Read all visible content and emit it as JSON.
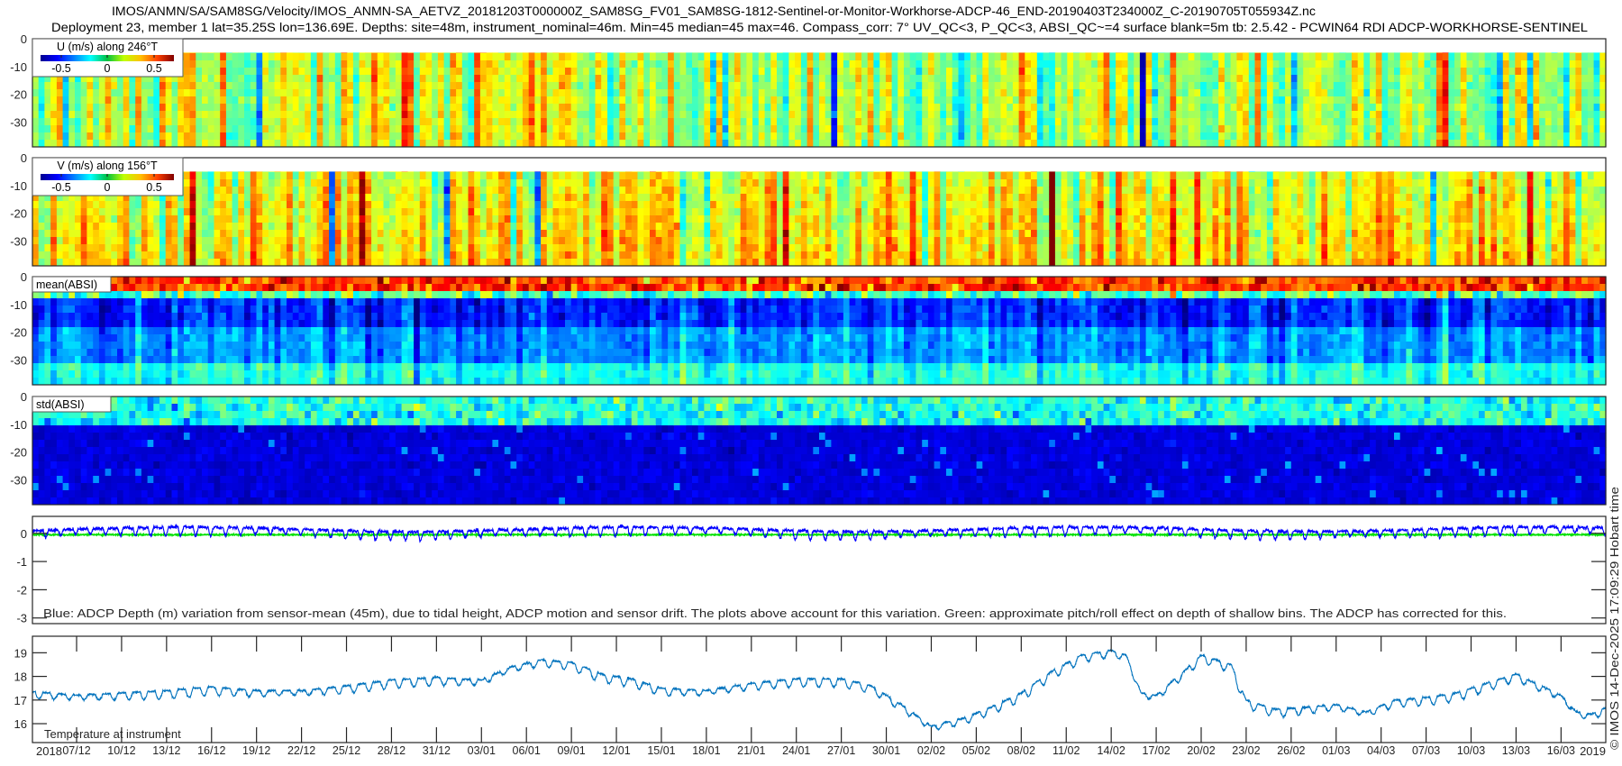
{
  "title": {
    "line1": "IMOS/ANMN/SA/SAM8SG/Velocity/IMOS_ANMN-SA_AETVZ_20181203T000000Z_SAM8SG_FV01_SAM8SG-1812-Sentinel-or-Monitor-Workhorse-ADCP-46_END-20190403T234000Z_C-20190705T055934Z.nc",
    "line2": "Deployment 23, member 1 lat=35.25S lon=136.69E. Depths: site=48m, instrument_nominal=46m. Min=45 median=45 max=46. Compass_corr: 7° UV_QC<3, P_QC<3, ABSI_QC~=4 surface blank=5m tb: 2.5.42 - PCWIN64 RDI ADCP-WORKHORSE-SENTINEL"
  },
  "side_stamp": "© IMOS 14-Dec-2025 17:09:29 Hobart time",
  "colors": {
    "depth_line": "#0000ff",
    "pitch_roll_line": "#00e000",
    "temperature_line": "#0072bd",
    "axis": "#262626"
  },
  "chart_data": {
    "type": "heatmap",
    "x_axis": {
      "start_date": "2018-12-04",
      "end_date": "2019-03-19",
      "tick_start_date": "2018-12-07",
      "tick_step_days": 3,
      "tick_labels": [
        "07/12",
        "10/12",
        "13/12",
        "16/12",
        "19/12",
        "22/12",
        "25/12",
        "28/12",
        "31/12",
        "03/01",
        "06/01",
        "09/01",
        "12/01",
        "15/01",
        "18/01",
        "21/01",
        "24/01",
        "27/01",
        "30/01",
        "02/02",
        "05/02",
        "08/02",
        "11/02",
        "14/02",
        "17/02",
        "20/02",
        "23/02",
        "26/02",
        "01/03",
        "04/03",
        "07/03",
        "10/03",
        "13/03",
        "16/03"
      ],
      "year_left": "2018",
      "year_right": "2019"
    },
    "panels": [
      {
        "id": "u",
        "type": "heatmap",
        "legend_title": "U (m/s) along 246°T",
        "colorbar_ticks": [
          "-0.5",
          "0",
          "0.5"
        ],
        "clim": [
          -0.7,
          0.7
        ],
        "ylim": [
          0,
          39
        ],
        "y_ticks": [
          "0",
          "-10",
          "-20",
          "-30"
        ],
        "blank_above_depth": 5,
        "mean_value": 0.08,
        "spread": 0.18
      },
      {
        "id": "v",
        "type": "heatmap",
        "legend_title": "V (m/s) along 156°T",
        "colorbar_ticks": [
          "-0.5",
          "0",
          "0.5"
        ],
        "clim": [
          -0.7,
          0.7
        ],
        "ylim": [
          0,
          39
        ],
        "y_ticks": [
          "0",
          "-10",
          "-20",
          "-30"
        ],
        "blank_above_depth": 5,
        "mean_value": 0.12,
        "spread": 0.16
      },
      {
        "id": "mean",
        "type": "heatmap",
        "legend_title": "mean(ABSI)",
        "ylim": [
          0,
          39
        ],
        "y_ticks": [
          "0",
          "-10",
          "-20",
          "-30"
        ]
      },
      {
        "id": "std",
        "type": "heatmap",
        "legend_title": "std(ABSI)",
        "ylim": [
          0,
          39
        ],
        "y_ticks": [
          "0",
          "-10",
          "-20",
          "-30"
        ]
      },
      {
        "id": "depth",
        "type": "line",
        "ylabel_ticks": [
          "0",
          "-1",
          "-2",
          "-3"
        ],
        "y_tick_values": [
          0,
          -1,
          -2,
          -3
        ],
        "ylim": [
          -3.2,
          0.6
        ],
        "annotation": "Blue: ADCP Depth (m) variation from sensor-mean (45m), due to tidal height, ADCP motion and sensor drift. The plots above account for this variation. Green: approximate pitch/roll effect on depth of shallow bins. The ADCP has corrected for this.",
        "series": [
          {
            "name": "ADCP depth variation",
            "mean": 0.15,
            "tidal_amplitude": 0.45
          },
          {
            "name": "pitch/roll effect",
            "value": -0.05
          }
        ]
      },
      {
        "id": "temp",
        "type": "line",
        "ylabel_ticks": [
          "16",
          "17",
          "18",
          "19"
        ],
        "y_tick_values": [
          16,
          17,
          18,
          19
        ],
        "ylim": [
          15.2,
          19.7
        ],
        "annotation": "Temperature at instrument",
        "series": [
          {
            "name": "Temperature at instrument",
            "points": [
              [
                "2018-12-04",
                17.35
              ],
              [
                "2018-12-07",
                17.2
              ],
              [
                "2018-12-10",
                17.3
              ],
              [
                "2018-12-13",
                17.4
              ],
              [
                "2018-12-16",
                17.55
              ],
              [
                "2018-12-19",
                17.4
              ],
              [
                "2018-12-22",
                17.4
              ],
              [
                "2018-12-25",
                17.6
              ],
              [
                "2018-12-28",
                17.85
              ],
              [
                "2018-12-31",
                17.95
              ],
              [
                "2019-01-03",
                17.85
              ],
              [
                "2019-01-05",
                18.4
              ],
              [
                "2019-01-07",
                18.7
              ],
              [
                "2019-01-09",
                18.6
              ],
              [
                "2019-01-11",
                18.1
              ],
              [
                "2019-01-13",
                17.9
              ],
              [
                "2019-01-15",
                17.5
              ],
              [
                "2019-01-18",
                17.4
              ],
              [
                "2019-01-21",
                17.7
              ],
              [
                "2019-01-24",
                17.9
              ],
              [
                "2019-01-27",
                17.9
              ],
              [
                "2019-01-29",
                17.6
              ],
              [
                "2019-01-31",
                16.8
              ],
              [
                "2019-02-02",
                15.9
              ],
              [
                "2019-02-04",
                16.2
              ],
              [
                "2019-02-06",
                16.7
              ],
              [
                "2019-02-08",
                17.3
              ],
              [
                "2019-02-10",
                18.2
              ],
              [
                "2019-02-12",
                18.9
              ],
              [
                "2019-02-14",
                19.1
              ],
              [
                "2019-02-15",
                18.9
              ],
              [
                "2019-02-16",
                17.3
              ],
              [
                "2019-02-17",
                17.2
              ],
              [
                "2019-02-19",
                18.3
              ],
              [
                "2019-02-20",
                18.9
              ],
              [
                "2019-02-22",
                18.5
              ],
              [
                "2019-02-23",
                17.0
              ],
              [
                "2019-02-25",
                16.6
              ],
              [
                "2019-02-27",
                16.7
              ],
              [
                "2019-03-01",
                16.8
              ],
              [
                "2019-03-03",
                16.5
              ],
              [
                "2019-03-05",
                17.0
              ],
              [
                "2019-03-07",
                17.1
              ],
              [
                "2019-03-09",
                17.3
              ],
              [
                "2019-03-11",
                17.7
              ],
              [
                "2019-03-13",
                18.1
              ],
              [
                "2019-03-14",
                17.8
              ],
              [
                "2019-03-16",
                17.2
              ],
              [
                "2019-03-17",
                16.5
              ],
              [
                "2019-03-18",
                16.4
              ],
              [
                "2019-03-19",
                16.7
              ]
            ]
          }
        ]
      }
    ]
  }
}
